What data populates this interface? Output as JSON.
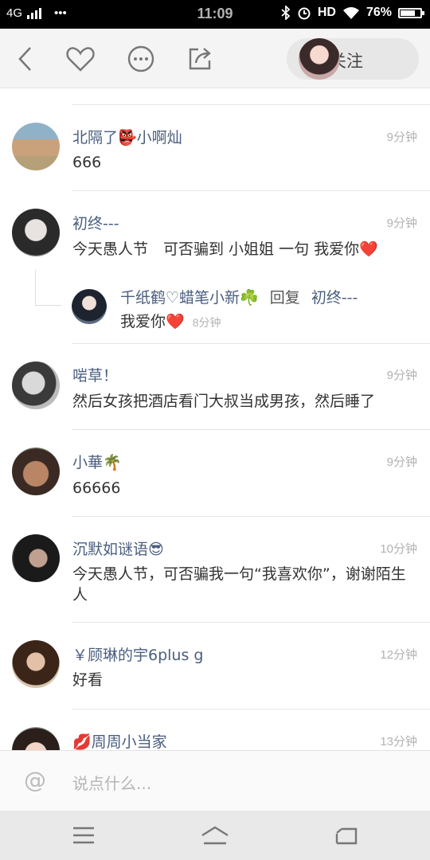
{
  "status_bar": {
    "network": "4G",
    "dots": "•••",
    "time": "11:09",
    "hd": "HD",
    "battery_text": "76%",
    "battery_level": 0.76,
    "icons": [
      "bluetooth-icon",
      "alarm-icon",
      "wifi-icon"
    ]
  },
  "toolbar": {
    "icons": [
      "back-icon",
      "heart-icon",
      "more-icon",
      "share-icon"
    ],
    "follow_plus": "+",
    "follow_label": "关注"
  },
  "comments": [
    {
      "name": "北隔了👺小啊灿",
      "time": "9分钟",
      "text": "666"
    },
    {
      "name": "初终---",
      "time": "9分钟",
      "text": "今天愚人节　可否骗到 小姐姐 一句 我爱你❤️",
      "reply": {
        "name": "千纸鹤♡蜡笔小新☘️",
        "action": "回复",
        "target": "初终---",
        "text": "我爱你❤️",
        "time": "8分钟"
      }
    },
    {
      "name": "啱草！",
      "time": "9分钟",
      "text": "然后女孩把酒店看门大叔当成男孩，然后睡了"
    },
    {
      "name": "小華🌴",
      "time": "9分钟",
      "text": "66666"
    },
    {
      "name": "沉默如谜语😎",
      "time": "10分钟",
      "text": "今天愚人节，可否骗我一句“我喜欢你”，谢谢陌生人"
    },
    {
      "name": "￥顾琳的宇6plus g",
      "time": "12分钟",
      "text": "好看"
    },
    {
      "name": "💋周周小当家",
      "time": "13分钟",
      "text": ""
    }
  ],
  "input": {
    "at_symbol": "@",
    "placeholder": "说点什么..."
  },
  "nav_bar": {
    "icons": [
      "menu-icon",
      "home-icon",
      "back-nav-icon"
    ]
  }
}
